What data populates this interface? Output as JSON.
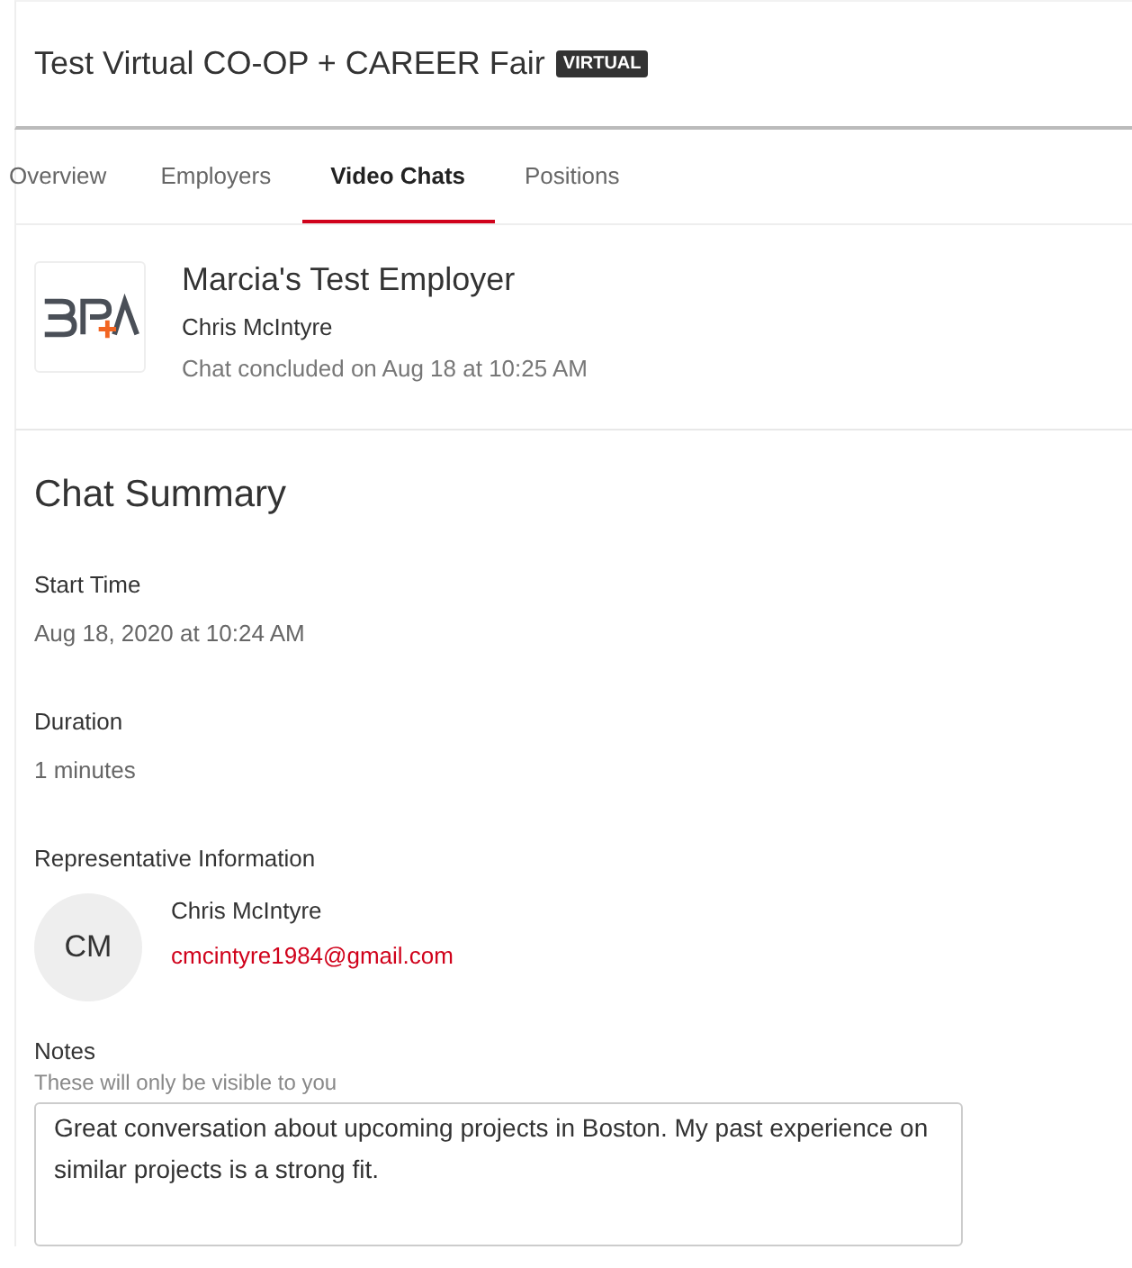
{
  "event": {
    "title": "Test Virtual CO-OP + CAREER Fair",
    "badge": "VIRTUAL"
  },
  "tabs": [
    {
      "label": "Overview",
      "selected": false
    },
    {
      "label": "Employers",
      "selected": false
    },
    {
      "label": "Video Chats",
      "selected": true
    },
    {
      "label": "Positions",
      "selected": false
    }
  ],
  "employer": {
    "name": "Marcia's Test Employer",
    "representative": "Chris McIntyre",
    "status": "Chat concluded on Aug 18 at 10:25 AM"
  },
  "summary": {
    "title": "Chat Summary",
    "fields": [
      {
        "label": "Start Time",
        "value": "Aug 18, 2020 at 10:24 AM"
      },
      {
        "label": "Duration",
        "value": "1 minutes"
      }
    ],
    "representative": {
      "label": "Representative Information",
      "initials": "CM",
      "name": "Chris McIntyre",
      "email": "cmcintyre1984@gmail.com"
    },
    "notes": {
      "label": "Notes",
      "hint": "These will only be visible to you",
      "value": "Great conversation about upcoming projects in Boston. My past experience on similar projects is a strong fit."
    }
  }
}
